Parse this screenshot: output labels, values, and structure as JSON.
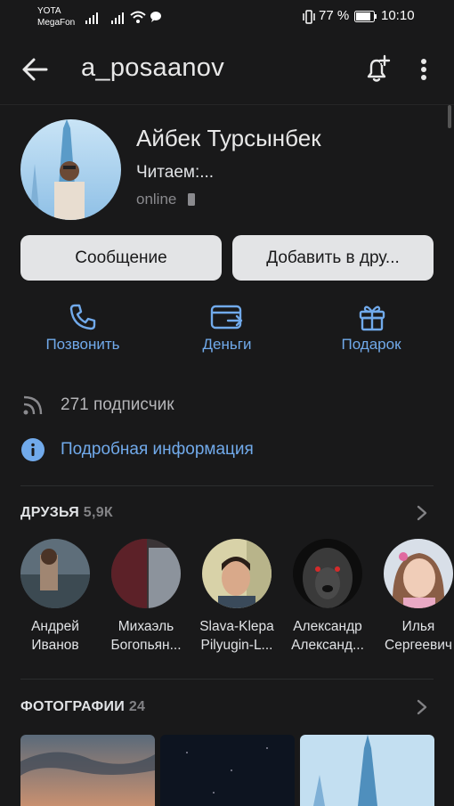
{
  "status_bar": {
    "carrier1": "YOTA",
    "carrier2": "MegaFon",
    "battery": "77 %",
    "time": "10:10"
  },
  "header": {
    "title": "a_posaanov"
  },
  "profile": {
    "name": "Айбек Турсынбек",
    "status": "Читаем:...",
    "online": "online"
  },
  "buttons": {
    "message": "Сообщение",
    "add_friend": "Добавить в дру..."
  },
  "actions": [
    {
      "label": "Позвонить",
      "icon": "phone-icon"
    },
    {
      "label": "Деньги",
      "icon": "money-transfer-icon"
    },
    {
      "label": "Подарок",
      "icon": "gift-icon"
    }
  ],
  "subscribers": "271 подписчик",
  "details_link": "Подробная информация",
  "friends": {
    "title": "ДРУЗЬЯ",
    "count": "5,9К",
    "items": [
      {
        "first": "Андрей",
        "last": "Иванов"
      },
      {
        "first": "Михаэль",
        "last": "Богопьян..."
      },
      {
        "first": "Slava-Klepa",
        "last": "Pilyugin-L..."
      },
      {
        "first": "Александр",
        "last": "Александ..."
      },
      {
        "first": "Илья",
        "last": "Сергеевич"
      }
    ]
  },
  "photos": {
    "title": "ФОТОГРАФИИ",
    "count": "24"
  },
  "colors": {
    "background": "#19191a",
    "accent": "#71aaeb",
    "button": "#e3e4e6"
  }
}
